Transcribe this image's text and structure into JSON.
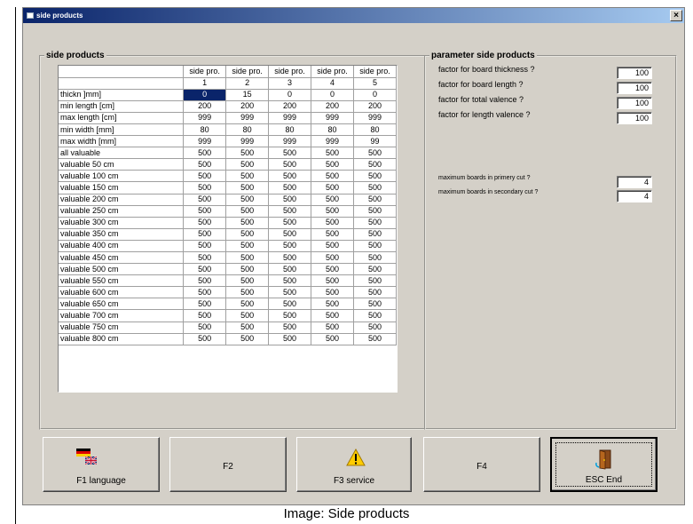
{
  "window": {
    "title": "side products",
    "close_label": "×"
  },
  "side_group": {
    "label": "side products"
  },
  "grid": {
    "columns": [
      {
        "top": "side pro.",
        "bottom": "1"
      },
      {
        "top": "side pro.",
        "bottom": "2"
      },
      {
        "top": "side pro.",
        "bottom": "3"
      },
      {
        "top": "side pro.",
        "bottom": "4"
      },
      {
        "top": "side pro.",
        "bottom": "5"
      }
    ],
    "rows": [
      {
        "label": "thickn ]mm]",
        "values": [
          "0",
          "15",
          "0",
          "0",
          "0"
        ]
      },
      {
        "label": "min length [cm]",
        "values": [
          "200",
          "200",
          "200",
          "200",
          "200"
        ]
      },
      {
        "label": "max length [cm]",
        "values": [
          "999",
          "999",
          "999",
          "999",
          "999"
        ]
      },
      {
        "label": "min width [mm]",
        "values": [
          "80",
          "80",
          "80",
          "80",
          "80"
        ]
      },
      {
        "label": "max width [mm]",
        "values": [
          "999",
          "999",
          "999",
          "999",
          "99"
        ]
      },
      {
        "label": "all valuable",
        "values": [
          "500",
          "500",
          "500",
          "500",
          "500"
        ]
      },
      {
        "label": "valuable 50 cm",
        "values": [
          "500",
          "500",
          "500",
          "500",
          "500"
        ]
      },
      {
        "label": "valuable 100 cm",
        "values": [
          "500",
          "500",
          "500",
          "500",
          "500"
        ]
      },
      {
        "label": "valuable 150 cm",
        "values": [
          "500",
          "500",
          "500",
          "500",
          "500"
        ]
      },
      {
        "label": "valuable 200 cm",
        "values": [
          "500",
          "500",
          "500",
          "500",
          "500"
        ]
      },
      {
        "label": "valuable 250 cm",
        "values": [
          "500",
          "500",
          "500",
          "500",
          "500"
        ]
      },
      {
        "label": "valuable 300 cm",
        "values": [
          "500",
          "500",
          "500",
          "500",
          "500"
        ]
      },
      {
        "label": "valuable 350 cm",
        "values": [
          "500",
          "500",
          "500",
          "500",
          "500"
        ]
      },
      {
        "label": "valuable 400 cm",
        "values": [
          "500",
          "500",
          "500",
          "500",
          "500"
        ]
      },
      {
        "label": "valuable 450 cm",
        "values": [
          "500",
          "500",
          "500",
          "500",
          "500"
        ]
      },
      {
        "label": "valuable 500 cm",
        "values": [
          "500",
          "500",
          "500",
          "500",
          "500"
        ]
      },
      {
        "label": "valuable 550 cm",
        "values": [
          "500",
          "500",
          "500",
          "500",
          "500"
        ]
      },
      {
        "label": "valuable 600 cm",
        "values": [
          "500",
          "500",
          "500",
          "500",
          "500"
        ]
      },
      {
        "label": "valuable 650 cm",
        "values": [
          "500",
          "500",
          "500",
          "500",
          "500"
        ]
      },
      {
        "label": "valuable 700 cm",
        "values": [
          "500",
          "500",
          "500",
          "500",
          "500"
        ]
      },
      {
        "label": "valuable 750 cm",
        "values": [
          "500",
          "500",
          "500",
          "500",
          "500"
        ]
      },
      {
        "label": "valuable 800 cm",
        "values": [
          "500",
          "500",
          "500",
          "500",
          "500"
        ]
      }
    ]
  },
  "param_group": {
    "label": "parameter side products",
    "factors": [
      {
        "label": "factor for board thickness ?",
        "value": "100"
      },
      {
        "label": "factor for board length ?",
        "value": "100"
      },
      {
        "label": "factor for total valence ?",
        "value": "100"
      },
      {
        "label": "factor for length valence ?",
        "value": "100"
      }
    ],
    "max_boards": [
      {
        "label": "maximum boards in primery cut ?",
        "value": "4"
      },
      {
        "label": "maximum boards in secondary cut ?",
        "value": "4"
      }
    ]
  },
  "function_keys": {
    "f1": "F1 language",
    "f2": "F2",
    "f3": "F3 service",
    "f4": "F4",
    "f5": "ESC End"
  },
  "caption": "Image: Side products"
}
